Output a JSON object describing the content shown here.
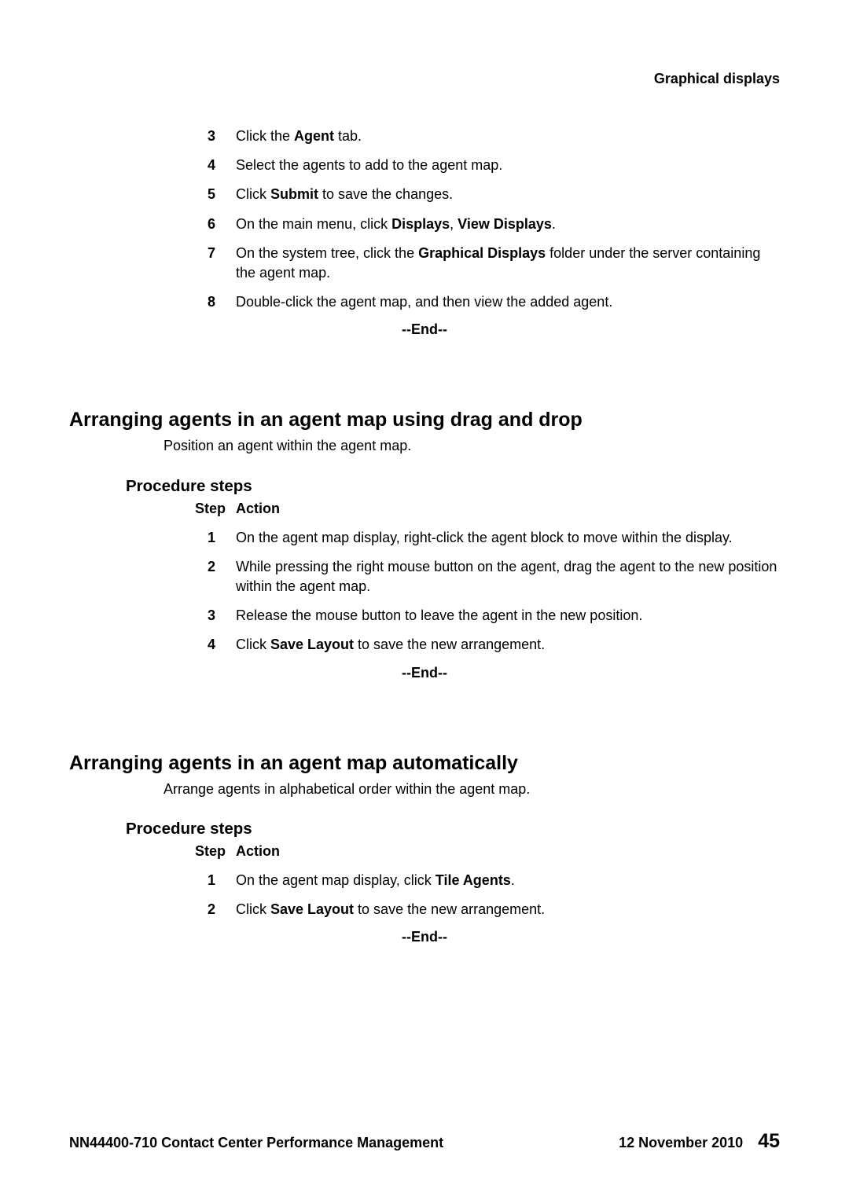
{
  "header": {
    "title": "Graphical displays"
  },
  "topSteps": [
    {
      "num": "3",
      "segments": [
        {
          "t": "Click the "
        },
        {
          "t": "Agent",
          "b": true
        },
        {
          "t": " tab."
        }
      ]
    },
    {
      "num": "4",
      "segments": [
        {
          "t": "Select the agents to add to the agent map."
        }
      ]
    },
    {
      "num": "5",
      "segments": [
        {
          "t": "Click "
        },
        {
          "t": "Submit",
          "b": true
        },
        {
          "t": " to save the changes."
        }
      ]
    },
    {
      "num": "6",
      "segments": [
        {
          "t": "On the main menu, click "
        },
        {
          "t": "Displays",
          "b": true
        },
        {
          "t": ", "
        },
        {
          "t": "View Displays",
          "b": true
        },
        {
          "t": "."
        }
      ]
    },
    {
      "num": "7",
      "segments": [
        {
          "t": "On the system tree, click the "
        },
        {
          "t": "Graphical Displays",
          "b": true
        },
        {
          "t": " folder under the server containing the agent map."
        }
      ]
    },
    {
      "num": "8",
      "segments": [
        {
          "t": "Double-click the agent map, and then view the added agent."
        }
      ]
    }
  ],
  "endMarker": "--End--",
  "section1": {
    "title": "Arranging agents in an agent map using drag and drop",
    "intro": "Position an agent within the agent map.",
    "subtitle": "Procedure steps",
    "stepLabel": "Step",
    "actionLabel": "Action",
    "steps": [
      {
        "num": "1",
        "segments": [
          {
            "t": "On the agent map display, right-click the agent block to move within the display."
          }
        ]
      },
      {
        "num": "2",
        "segments": [
          {
            "t": "While pressing the right mouse button on the agent, drag the agent to the new position within the agent map."
          }
        ]
      },
      {
        "num": "3",
        "segments": [
          {
            "t": "Release the mouse button to leave the agent in the new position."
          }
        ]
      },
      {
        "num": "4",
        "segments": [
          {
            "t": "Click "
          },
          {
            "t": "Save Layout",
            "b": true
          },
          {
            "t": " to save the new arrangement."
          }
        ]
      }
    ]
  },
  "section2": {
    "title": "Arranging agents in an agent map automatically",
    "intro": "Arrange agents in alphabetical order within the agent map.",
    "subtitle": "Procedure steps",
    "stepLabel": "Step",
    "actionLabel": "Action",
    "steps": [
      {
        "num": "1",
        "segments": [
          {
            "t": "On the agent map display, click "
          },
          {
            "t": "Tile Agents",
            "b": true
          },
          {
            "t": "."
          }
        ]
      },
      {
        "num": "2",
        "segments": [
          {
            "t": "Click "
          },
          {
            "t": "Save Layout",
            "b": true
          },
          {
            "t": " to save the new arrangement."
          }
        ]
      }
    ]
  },
  "footer": {
    "left": "NN44400-710 Contact Center Performance Management",
    "date": "12 November 2010",
    "page": "45"
  }
}
